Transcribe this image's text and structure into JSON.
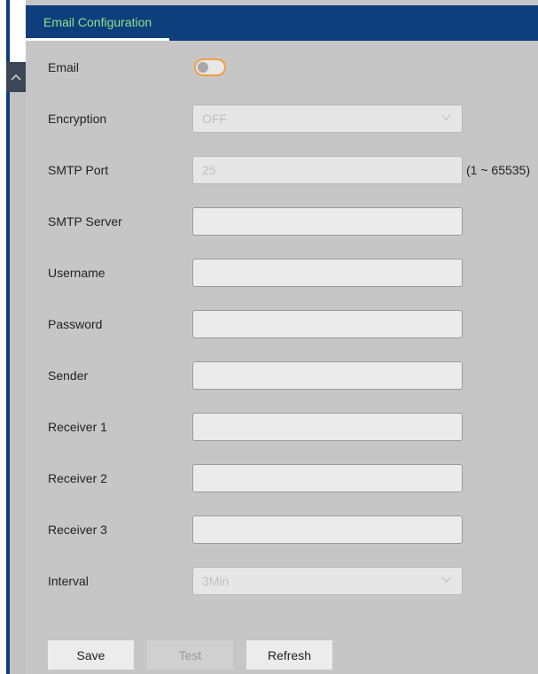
{
  "header": {
    "tab_label": "Email Configuration"
  },
  "form": {
    "email": {
      "label": "Email",
      "enabled": false
    },
    "encryption": {
      "label": "Encryption",
      "value": "OFF"
    },
    "smtp_port": {
      "label": "SMTP Port",
      "value": "25",
      "hint": "(1 ~ 65535)"
    },
    "smtp_server": {
      "label": "SMTP Server",
      "value": ""
    },
    "username": {
      "label": "Username",
      "value": ""
    },
    "password": {
      "label": "Password",
      "value": ""
    },
    "sender": {
      "label": "Sender",
      "value": ""
    },
    "receiver1": {
      "label": "Receiver 1",
      "value": ""
    },
    "receiver2": {
      "label": "Receiver 2",
      "value": ""
    },
    "receiver3": {
      "label": "Receiver 3",
      "value": ""
    },
    "interval": {
      "label": "Interval",
      "value": "3Min"
    }
  },
  "buttons": {
    "save": "Save",
    "test": "Test",
    "refresh": "Refresh"
  },
  "colors": {
    "header_bg": "#0e3e7b",
    "tab_text": "#8fe28f",
    "panel_bg": "#c6c6c6",
    "toggle_border": "#f0a040"
  },
  "icons": {
    "collapse": "chevron-up-icon",
    "select_arrow": "chevron-down-icon"
  }
}
